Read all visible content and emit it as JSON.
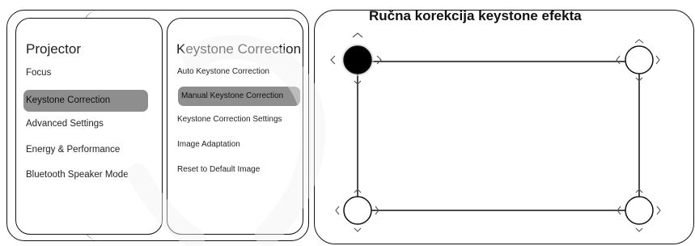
{
  "projector_menu": {
    "title": "Projector",
    "items": [
      {
        "label": "Focus"
      },
      {
        "label": "Keystone Correction",
        "selected": true
      },
      {
        "label": "Advanced Settings"
      },
      {
        "label": "Energy & Performance"
      },
      {
        "label": "Bluetooth Speaker Mode"
      }
    ]
  },
  "keystone_menu": {
    "title": "Keystone Correction",
    "items": [
      {
        "label": "Auto Keystone Correction"
      },
      {
        "label": "Manual Keystone Correction",
        "selected": true
      },
      {
        "label": "Keystone Correction Settings"
      },
      {
        "label": "Image Adaptation"
      },
      {
        "label": "Reset to Default Image"
      }
    ]
  },
  "manual_overlay": {
    "title": "Ručna korekcija keystone efekta",
    "active_corner": "top-left"
  },
  "colors": {
    "selected_bg": "#8e8e8e",
    "border": "#111111",
    "active_handle": "#000000"
  },
  "icons": [
    "chevron-up-icon",
    "chevron-down-icon",
    "chevron-left-icon",
    "chevron-right-icon"
  ]
}
